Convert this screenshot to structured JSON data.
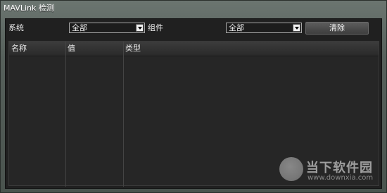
{
  "window": {
    "title": "MAVLink 检测"
  },
  "filters": {
    "system_label": "系统",
    "system_value": "全部",
    "component_label": "组件",
    "component_value": "全部",
    "clear_label": "清除"
  },
  "table": {
    "columns": [
      "名称",
      "值",
      "类型"
    ]
  },
  "watermark": {
    "title": "当下软件园",
    "url": "www.downxia.com"
  },
  "icons": {
    "dropdown": "chevron-down-icon",
    "logo": "logo-icon"
  }
}
